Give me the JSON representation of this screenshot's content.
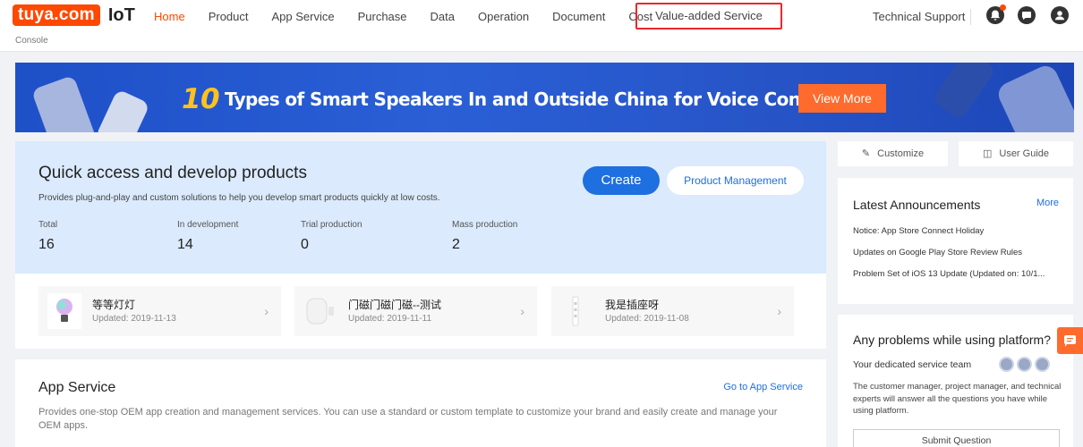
{
  "header": {
    "logo_text": "tuya.com",
    "product_name": "IoT",
    "breadcrumb": "Console",
    "nav": [
      {
        "label": "Home",
        "active": true
      },
      {
        "label": "Product",
        "active": false
      },
      {
        "label": "App Service",
        "active": false
      },
      {
        "label": "Purchase",
        "active": false
      },
      {
        "label": "Data",
        "active": false
      },
      {
        "label": "Operation",
        "active": false
      },
      {
        "label": "Document",
        "active": false
      },
      {
        "label": "Cost",
        "active": false
      }
    ],
    "highlighted_nav": "Value-added Service",
    "tech_support": "Technical Support",
    "icons": [
      "bell-icon",
      "message-icon",
      "user-icon"
    ],
    "accent": "#ff4800"
  },
  "banner": {
    "highlight_number": "10",
    "title": "Types of Smart Speakers In and Outside China for Voice Control",
    "button": "View More"
  },
  "quick_access": {
    "title": "Quick access and develop products",
    "description": "Provides plug-and-play and custom solutions to help you develop smart products quickly at low costs.",
    "create_button": "Create",
    "manage_button": "Product Management",
    "stats": [
      {
        "label": "Total",
        "value": "16"
      },
      {
        "label": "In development",
        "value": "14"
      },
      {
        "label": "Trial production",
        "value": "0"
      },
      {
        "label": "Mass production",
        "value": "2"
      }
    ],
    "products": [
      {
        "name": "等等灯灯",
        "updated": "Updated: 2019-11-13"
      },
      {
        "name": "门磁门磁门磁--测试",
        "updated": "Updated: 2019-11-11"
      },
      {
        "name": "我是插座呀",
        "updated": "Updated: 2019-11-08"
      }
    ]
  },
  "app_service": {
    "title": "App Service",
    "link": "Go to App Service",
    "description": "Provides one-stop OEM app creation and management services. You can use a standard or custom template to customize your brand and easily create and manage your OEM apps."
  },
  "sidebar": {
    "customize": "Customize",
    "user_guide": "User Guide",
    "announcements": {
      "title": "Latest Announcements",
      "more": "More",
      "items": [
        "Notice: App Store Connect Holiday",
        "Updates on Google Play Store Review Rules",
        "Problem Set of iOS 13 Update (Updated on: 10/1..."
      ]
    },
    "help": {
      "title": "Any problems while using platform?",
      "team": "Your dedicated service team",
      "description": "The customer manager, project manager, and technical experts will answer all the questions you have while using platform.",
      "button": "Submit Question"
    }
  }
}
